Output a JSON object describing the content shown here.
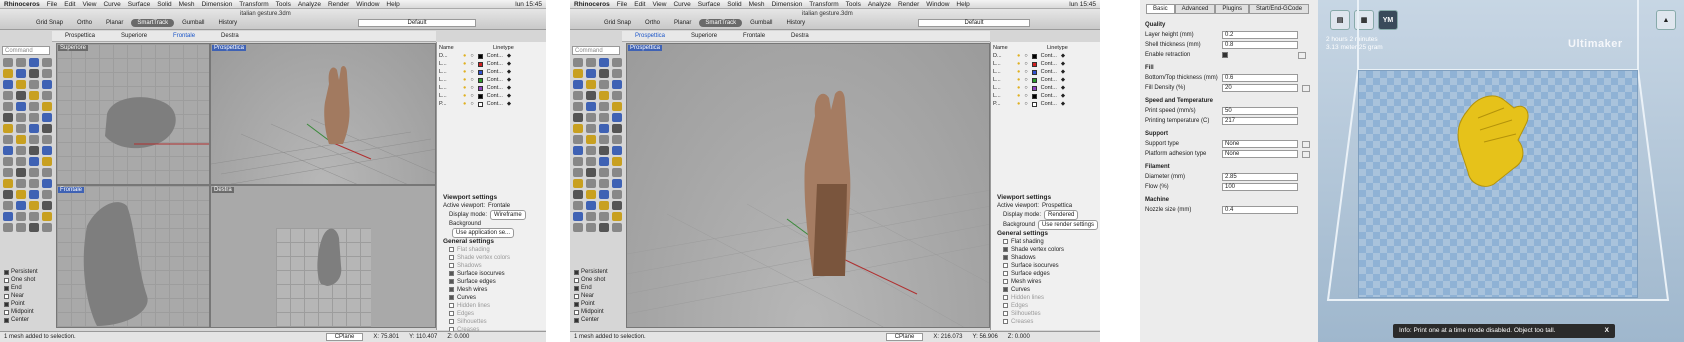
{
  "rhino": {
    "menubar": [
      "Rhinoceros",
      "File",
      "Edit",
      "View",
      "Curve",
      "Surface",
      "Solid",
      "Mesh",
      "Dimension",
      "Transform",
      "Tools",
      "Analyze",
      "Render",
      "Window",
      "Help"
    ],
    "clock": "lun 15:45",
    "doc_title": "italian gesture.3dm",
    "modes": [
      "Grid Snap",
      "Ortho",
      "Planar",
      "SmartTrack",
      "Gumball",
      "History"
    ],
    "active_mode": "SmartTrack",
    "layer": "Default",
    "view_tabs": [
      "Prospettica",
      "Superiore",
      "Frontale",
      "Destra"
    ],
    "command_placeholder": "Command",
    "osnaps": [
      {
        "label": "Persistent",
        "checked": true
      },
      {
        "label": "One shot",
        "checked": false
      },
      {
        "label": "End",
        "checked": true
      },
      {
        "label": "Near",
        "checked": false
      },
      {
        "label": "Point",
        "checked": true
      },
      {
        "label": "Midpoint",
        "checked": false
      },
      {
        "label": "Center",
        "checked": true
      }
    ],
    "layers_header": [
      "Name",
      "Linetype"
    ],
    "layer_rows": [
      {
        "name": "D...",
        "color": "#000000",
        "lt": "Cont..."
      },
      {
        "name": "L...",
        "color": "#d42020",
        "lt": "Cont..."
      },
      {
        "name": "L...",
        "color": "#3050d0",
        "lt": "Cont..."
      },
      {
        "name": "L...",
        "color": "#2a9a2a",
        "lt": "Cont..."
      },
      {
        "name": "L...",
        "color": "#9040c0",
        "lt": "Cont..."
      },
      {
        "name": "L...",
        "color": "#000000",
        "lt": "Cont..."
      },
      {
        "name": "P...",
        "color": "#ffffff",
        "lt": "Cont..."
      }
    ],
    "status": "1 mesh added to selection."
  },
  "window1": {
    "active_tab": "Frontale",
    "viewports": {
      "tl": "Superiore",
      "tr": "Prospettica",
      "bl": "Frontale",
      "br": "Destra"
    },
    "settings": {
      "title": "Viewport settings",
      "active_viewport_label": "Active viewport:",
      "active_viewport": "Frontale",
      "display_mode_label": "Display mode:",
      "display_mode": "Wireframe",
      "background_label": "Background",
      "background": "Use application se...",
      "general_title": "General settings",
      "options": [
        {
          "label": "Flat shading",
          "checked": false,
          "dim": true
        },
        {
          "label": "Shade vertex colors",
          "checked": false,
          "dim": true
        },
        {
          "label": "Shadows",
          "checked": false,
          "dim": true
        },
        {
          "label": "Surface isocurves",
          "checked": true,
          "dim": false
        },
        {
          "label": "Surface edges",
          "checked": true,
          "dim": false
        },
        {
          "label": "Mesh wires",
          "checked": true,
          "dim": false
        },
        {
          "label": "Curves",
          "checked": true,
          "dim": false
        },
        {
          "label": "Hidden lines",
          "checked": false,
          "dim": true
        },
        {
          "label": "Edges",
          "checked": false,
          "dim": true
        },
        {
          "label": "Silhouettes",
          "checked": false,
          "dim": true
        },
        {
          "label": "Creases",
          "checked": false,
          "dim": true
        }
      ]
    },
    "cplane": "CPlane",
    "x": "X: 75.801",
    "y": "Y: 110.407",
    "z": "Z: 0.000"
  },
  "window2": {
    "active_tab": "Prospettica",
    "viewport": "Prospettica",
    "settings": {
      "title": "Viewport settings",
      "active_viewport_label": "Active viewport:",
      "active_viewport": "Prospettica",
      "display_mode_label": "Display mode:",
      "display_mode": "Rendered",
      "background_label": "Background",
      "background": "Use render settings",
      "general_title": "General settings",
      "options": [
        {
          "label": "Flat shading",
          "checked": false,
          "dim": false
        },
        {
          "label": "Shade vertex colors",
          "checked": true,
          "dim": false
        },
        {
          "label": "Shadows",
          "checked": true,
          "dim": false
        },
        {
          "label": "Surface isocurves",
          "checked": false,
          "dim": false
        },
        {
          "label": "Surface edges",
          "checked": false,
          "dim": false
        },
        {
          "label": "Mesh wires",
          "checked": false,
          "dim": false
        },
        {
          "label": "Curves",
          "checked": true,
          "dim": false
        },
        {
          "label": "Hidden lines",
          "checked": false,
          "dim": true
        },
        {
          "label": "Edges",
          "checked": false,
          "dim": true
        },
        {
          "label": "Silhouettes",
          "checked": false,
          "dim": true
        },
        {
          "label": "Creases",
          "checked": false,
          "dim": true
        }
      ]
    },
    "cplane": "CPlane",
    "x": "X: 216.073",
    "y": "Y: 56.906",
    "z": "Z: 0.000"
  },
  "cura": {
    "tabs": [
      "Basic",
      "Advanced",
      "Plugins",
      "Start/End-GCode"
    ],
    "active_tab": "Basic",
    "sections": [
      {
        "title": "Quality",
        "rows": [
          {
            "label": "Layer height (mm)",
            "value": "0.2"
          },
          {
            "label": "Shell thickness (mm)",
            "value": "0.8"
          },
          {
            "label": "Enable retraction",
            "check": true
          }
        ]
      },
      {
        "title": "Fill",
        "rows": [
          {
            "label": "Bottom/Top thickness (mm)",
            "value": "0.6"
          },
          {
            "label": "Fill Density (%)",
            "value": "20"
          }
        ]
      },
      {
        "title": "Speed and Temperature",
        "rows": [
          {
            "label": "Print speed (mm/s)",
            "value": "50"
          },
          {
            "label": "Printing temperature (C)",
            "value": "217"
          }
        ]
      },
      {
        "title": "Support",
        "rows": [
          {
            "label": "Support type",
            "value": "None"
          },
          {
            "label": "Platform adhesion type",
            "value": "None"
          }
        ]
      },
      {
        "title": "Filament",
        "rows": [
          {
            "label": "Diameter (mm)",
            "value": "2.85"
          },
          {
            "label": "Flow (%)",
            "value": "100"
          }
        ]
      },
      {
        "title": "Machine",
        "rows": [
          {
            "label": "Nozzle size (mm)",
            "value": "0.4"
          }
        ]
      }
    ],
    "print_time_1": "2 hours 2 minutes",
    "print_time_2": "3.13 meter 25 gram",
    "brand": "Ultimaker",
    "view_buttons": [
      "YM"
    ],
    "info": "Info: Print one at a time mode disabled. Object too tall.",
    "info_close": "X"
  }
}
